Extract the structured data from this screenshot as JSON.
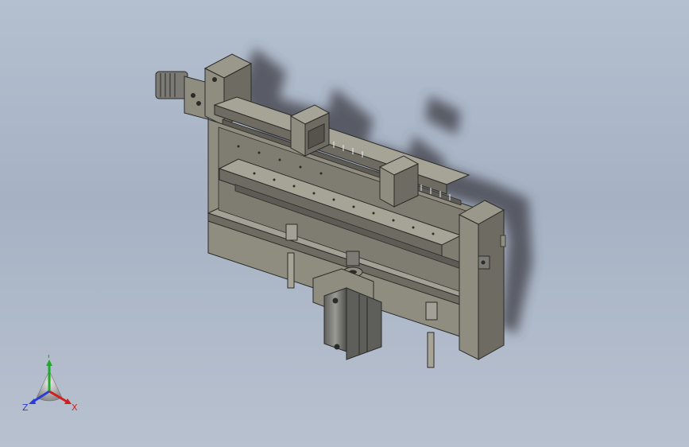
{
  "viewport": {
    "background_top": "#b4bfcf",
    "background_bottom": "#b8c1cf"
  },
  "model": {
    "body_color": "#8f8d80",
    "shade_color": "#6e6c62",
    "edge_color": "#2b2b27",
    "shadow_color": "#3c3e44",
    "components": [
      "cylinder-actuator-left",
      "rear-rail",
      "front-rail",
      "slider-bracket-1",
      "slider-bracket-2",
      "end-plate-right",
      "base-tray",
      "servo-motor",
      "support-pins"
    ]
  },
  "triad": {
    "y_label": "Y",
    "x_label": "X",
    "z_label": "Z",
    "y_color": "#1faa2a",
    "x_color": "#d11f1f",
    "z_color": "#2a3bd6"
  }
}
